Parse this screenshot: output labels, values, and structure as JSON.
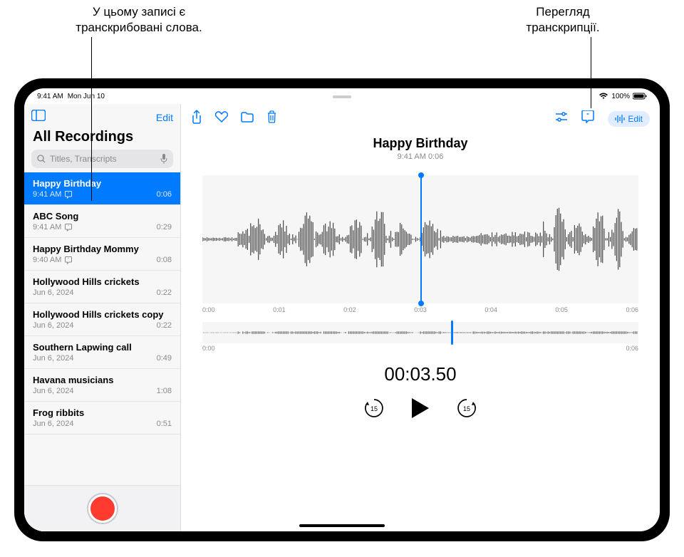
{
  "callouts": {
    "left": "У цьому записі є\nтранскрибовані слова.",
    "right": "Перегляд\nтранскрипції."
  },
  "status": {
    "time": "9:41 AM",
    "date": "Mon Jun 10",
    "battery": "100%"
  },
  "sidebar": {
    "edit": "Edit",
    "title": "All Recordings",
    "search_placeholder": "Titles, Transcripts",
    "items": [
      {
        "title": "Happy Birthday",
        "time": "9:41 AM",
        "duration": "0:06",
        "transcript": true,
        "selected": true
      },
      {
        "title": "ABC Song",
        "time": "9:41 AM",
        "duration": "0:29",
        "transcript": true,
        "selected": false
      },
      {
        "title": "Happy Birthday Mommy",
        "time": "9:40 AM",
        "duration": "0:08",
        "transcript": true,
        "selected": false
      },
      {
        "title": "Hollywood Hills crickets",
        "time": "Jun 6, 2024",
        "duration": "0:22",
        "transcript": false,
        "selected": false
      },
      {
        "title": "Hollywood Hills crickets copy",
        "time": "Jun 6, 2024",
        "duration": "0:22",
        "transcript": false,
        "selected": false
      },
      {
        "title": "Southern Lapwing call",
        "time": "Jun 6, 2024",
        "duration": "0:49",
        "transcript": false,
        "selected": false
      },
      {
        "title": "Havana musicians",
        "time": "Jun 6, 2024",
        "duration": "1:08",
        "transcript": false,
        "selected": false
      },
      {
        "title": "Frog ribbits",
        "time": "Jun 6, 2024",
        "duration": "0:51",
        "transcript": false,
        "selected": false
      }
    ]
  },
  "main": {
    "title": "Happy Birthday",
    "meta": "9:41 AM   0:06",
    "edit_label": "Edit",
    "time_labels": [
      "0:00",
      "0:01",
      "0:02",
      "0:03",
      "0:04",
      "0:05",
      "0:06"
    ],
    "small_start": "0:00",
    "small_end": "0:06",
    "timer": "00:03.50"
  }
}
